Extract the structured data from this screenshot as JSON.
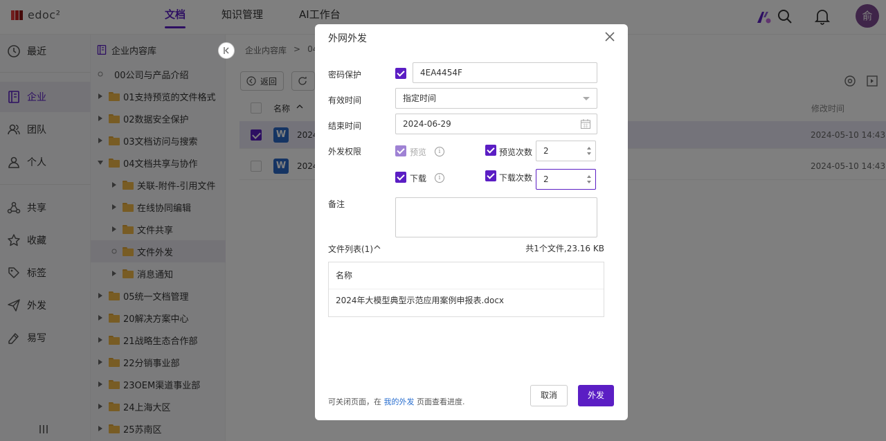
{
  "app": {
    "logo_text": "edoc²"
  },
  "nav": {
    "tabs": [
      {
        "label": "文档"
      },
      {
        "label": "知识管理"
      },
      {
        "label": "AI工作台"
      }
    ]
  },
  "header": {
    "avatar_text": "俞"
  },
  "sidebar": {
    "items": [
      {
        "label": "最近"
      },
      {
        "label": "企业"
      },
      {
        "label": "团队"
      },
      {
        "label": "个人"
      },
      {
        "label": "共享"
      },
      {
        "label": "收藏"
      },
      {
        "label": "标签"
      },
      {
        "label": "外发"
      },
      {
        "label": "易写"
      }
    ]
  },
  "tree": {
    "title": "企业内容库",
    "rows": [
      {
        "label": "00公司与产品介绍"
      },
      {
        "label": "01支持预览的文件格式"
      },
      {
        "label": "02数据安全保护"
      },
      {
        "label": "03文档访问与搜索"
      },
      {
        "label": "04文档共享与协作"
      },
      {
        "label": "关联-附件-引用文件"
      },
      {
        "label": "在线协同编辑"
      },
      {
        "label": "文件共享"
      },
      {
        "label": "文件外发"
      },
      {
        "label": "消息通知"
      },
      {
        "label": "05统一文档管理"
      },
      {
        "label": "20解决方案中心"
      },
      {
        "label": "21战略生态合作部"
      },
      {
        "label": "22分销事业部"
      },
      {
        "label": "23OEM渠道事业部"
      },
      {
        "label": "24上海大区"
      },
      {
        "label": "25苏南区"
      }
    ]
  },
  "main": {
    "breadcrumb": {
      "root": "企业内容库",
      "sep": ">",
      "current": "04"
    },
    "back_label": "返回",
    "col_name": "名称",
    "col_modified": "修改时间",
    "files": [
      {
        "name": "2024",
        "modified": "2024-05-10 14:43"
      },
      {
        "name": "2024",
        "modified": "2024-05-10 14:43"
      }
    ]
  },
  "modal": {
    "title": "外网外发",
    "password_label": "密码保护",
    "password_value": "4EA4454F",
    "valid_label": "有效时间",
    "valid_value": "指定时间",
    "end_label": "结束时间",
    "end_value": "2024-06-29",
    "perm_label": "外发权限",
    "preview_label": "预览",
    "preview_count_label": "预览次数",
    "preview_count": "2",
    "download_label": "下载",
    "download_count_label": "下载次数",
    "download_count": "2",
    "remark_label": "备注",
    "file_list_label": "文件列表(1)",
    "file_summary": "共1个文件,23.16 KB",
    "table_col_name": "名称",
    "file_name": "2024年大模型典型示范应用案例申报表.docx",
    "note_before": "可关闭页面，在 ",
    "note_link": "我的外发",
    "note_after": " 页面查看进度.",
    "cancel_label": "取消",
    "send_label": "外发"
  },
  "colors": {
    "accent": "#5b1ec4",
    "folder": "#f0b848",
    "word": "#2b68c7",
    "avatar": "#7e4a93"
  }
}
